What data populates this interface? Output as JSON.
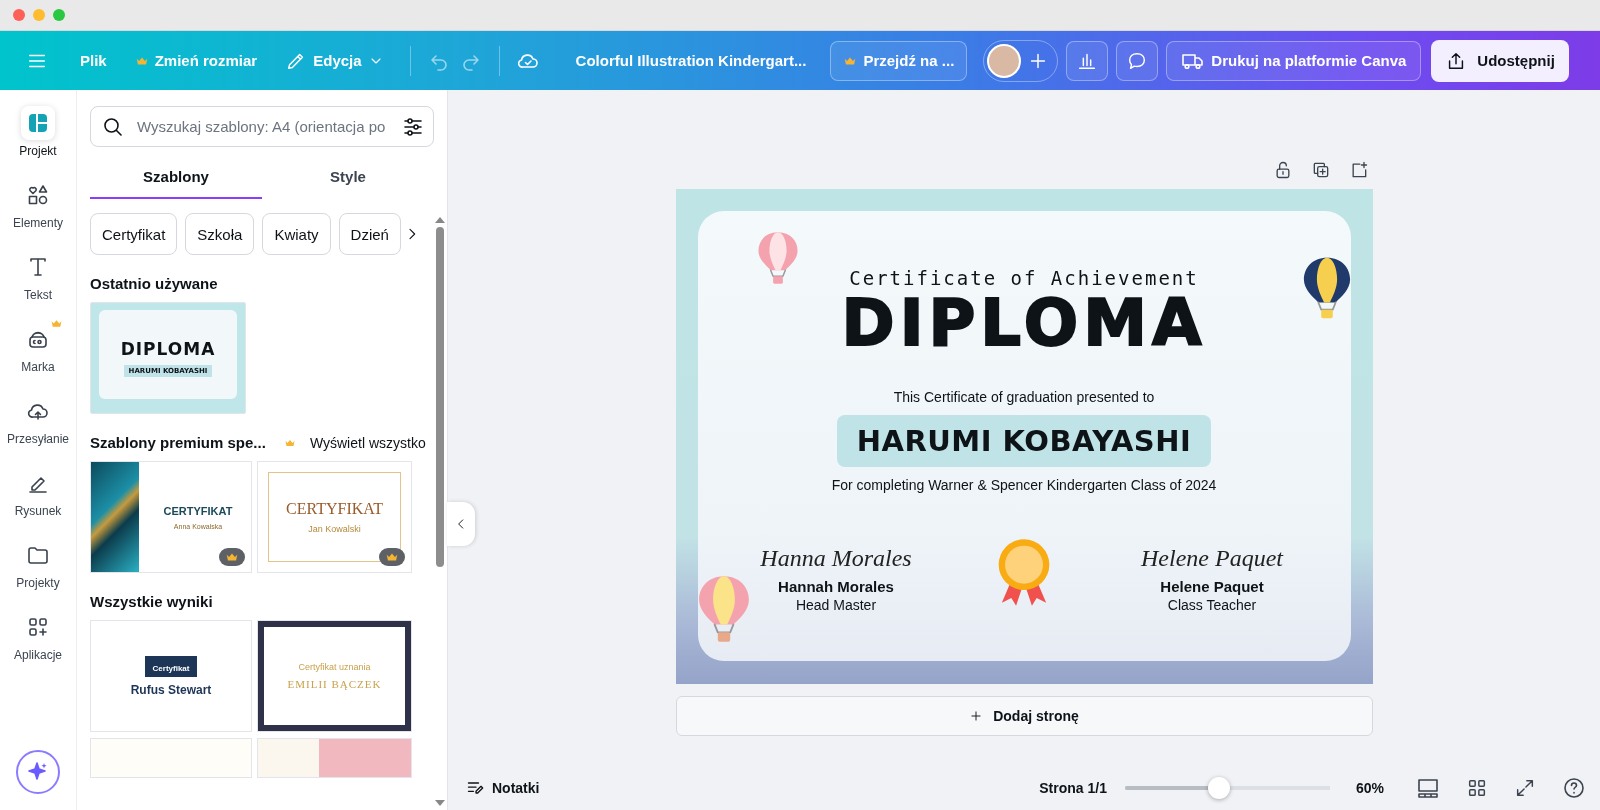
{
  "toolbar": {
    "menu": "Plik",
    "resize": "Zmień rozmiar",
    "edit": "Edycja",
    "document_title": "Colorful Illustration Kindergart...",
    "upgrade": "Przejdź na ...",
    "print": "Drukuj na platformie Canva",
    "share": "Udostępnij"
  },
  "rail": [
    {
      "kind": "design",
      "label": "Projekt",
      "selected": true,
      "premium": false
    },
    {
      "kind": "elements",
      "label": "Elementy",
      "selected": false,
      "premium": false
    },
    {
      "kind": "text",
      "label": "Tekst",
      "selected": false,
      "premium": false
    },
    {
      "kind": "brand",
      "label": "Marka",
      "selected": false,
      "premium": true
    },
    {
      "kind": "uploads",
      "label": "Przesyłanie",
      "selected": false,
      "premium": false
    },
    {
      "kind": "draw",
      "label": "Rysunek",
      "selected": false,
      "premium": false
    },
    {
      "kind": "projects",
      "label": "Projekty",
      "selected": false,
      "premium": false
    },
    {
      "kind": "apps",
      "label": "Aplikacje",
      "selected": false,
      "premium": false
    }
  ],
  "panel": {
    "search": {
      "placeholder": "Wyszukaj szablony: A4 (orientacja po"
    },
    "tabs": [
      {
        "label": "Szablony",
        "selected": true
      },
      {
        "label": "Style",
        "selected": false
      }
    ],
    "chips": [
      "Certyfikat",
      "Szkoła",
      "Kwiaty",
      "Dzień"
    ],
    "sections": [
      {
        "title": "Ostatnio używane",
        "templates": [
          {
            "kind": "diploma",
            "title": "DIPLOMA",
            "name": "HARUMI KOBAYASHI",
            "premium": false
          }
        ]
      },
      {
        "title": "Szablony premium spe...",
        "link": "Wyświetl wszystko",
        "premium": true,
        "templates": [
          {
            "kind": "marble",
            "title": "CERTYFIKAT",
            "name": "Anna Kowalska",
            "premium": true
          },
          {
            "kind": "frame",
            "title": "CERTYFIKAT",
            "name": "Jan Kowalski",
            "premium": true
          }
        ]
      },
      {
        "title": "Wszystkie wyniki",
        "templates": [
          {
            "kind": "banner",
            "title": "Certyfikat",
            "name": "Rufus Stewart",
            "premium": false
          },
          {
            "kind": "gold",
            "title": "Certyfikat uznania",
            "name": "EMILII BĄCZEK",
            "premium": false
          },
          {
            "kind": "cream",
            "premium": false
          },
          {
            "kind": "pink",
            "premium": false
          }
        ]
      }
    ]
  },
  "certificate": {
    "heading": "Certificate of Achievement",
    "title": "DIPLOMA",
    "intro": "This Certificate of graduation presented to",
    "name": "HARUMI KOBAYASHI",
    "reason": "For completing Warner & Spencer Kindergarten Class of 2024",
    "signers": [
      {
        "signature": "Hanna Morales",
        "name": "Hannah Morales",
        "role": "Head Master"
      },
      {
        "signature": "Helene Paquet",
        "name": "Helene Paquet",
        "role": "Class Teacher"
      }
    ]
  },
  "add_page": "Dodaj stronę",
  "footer": {
    "notes": "Notatki",
    "page": "Strona 1/1",
    "zoom": {
      "level": 0.46
    },
    "zoom_reading": "60%"
  }
}
